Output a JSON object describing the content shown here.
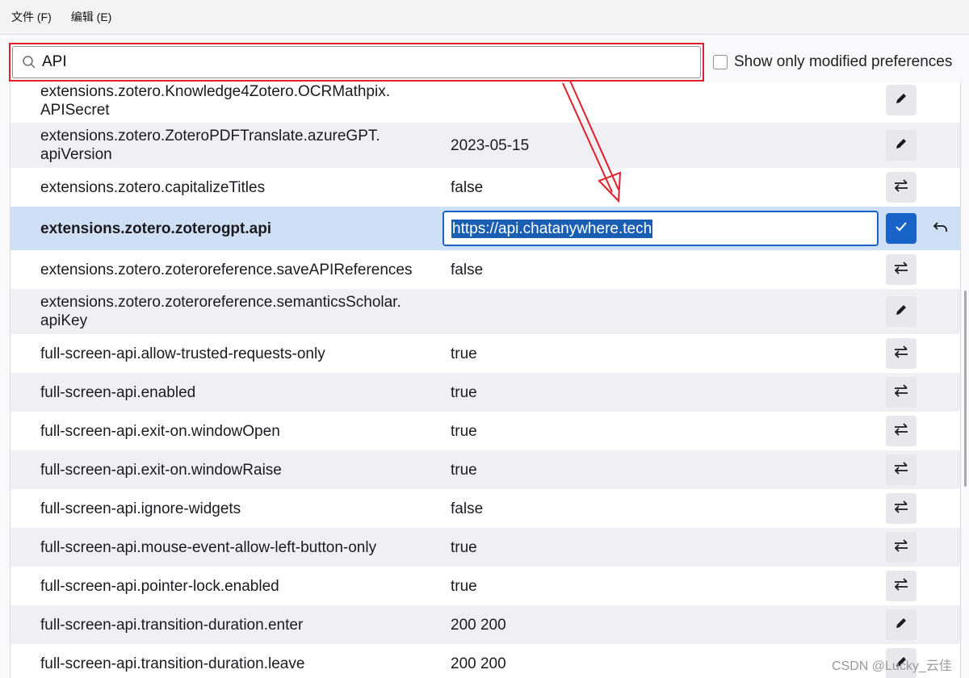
{
  "menu": {
    "file": "文件 (F)",
    "edit": "编辑 (E)"
  },
  "search": {
    "value": "API",
    "placeholder": ""
  },
  "show_modified": {
    "label": "Show only modified preferences",
    "checked": false
  },
  "rows": [
    {
      "name_line1": "extensions.zotero.Knowledge4Zotero.OCRMathpix.",
      "name_line2": "APISecret",
      "value": "",
      "action": "edit-icon"
    },
    {
      "name_line1": "extensions.zotero.ZoteroPDFTranslate.azureGPT.",
      "name_line2": "apiVersion",
      "value": "2023-05-15",
      "action": "edit-icon"
    },
    {
      "name": "extensions.zotero.capitalizeTitles",
      "value": "false",
      "action": "toggle-icon"
    },
    {
      "name": "extensions.zotero.zoterogpt.api",
      "value": "https://api.chatanywhere.tech",
      "action": "check-icon",
      "editing": true
    },
    {
      "name": "extensions.zotero.zoteroreference.saveAPIReferences",
      "value": "false",
      "action": "toggle-icon"
    },
    {
      "name_line1": "extensions.zotero.zoteroreference.semanticsScholar.",
      "name_line2": "apiKey",
      "value": "",
      "action": "edit-icon"
    },
    {
      "name": "full-screen-api.allow-trusted-requests-only",
      "value": "true",
      "action": "toggle-icon"
    },
    {
      "name": "full-screen-api.enabled",
      "value": "true",
      "action": "toggle-icon"
    },
    {
      "name": "full-screen-api.exit-on.windowOpen",
      "value": "true",
      "action": "toggle-icon"
    },
    {
      "name": "full-screen-api.exit-on.windowRaise",
      "value": "true",
      "action": "toggle-icon"
    },
    {
      "name": "full-screen-api.ignore-widgets",
      "value": "false",
      "action": "toggle-icon"
    },
    {
      "name": "full-screen-api.mouse-event-allow-left-button-only",
      "value": "true",
      "action": "toggle-icon"
    },
    {
      "name": "full-screen-api.pointer-lock.enabled",
      "value": "true",
      "action": "toggle-icon"
    },
    {
      "name": "full-screen-api.transition-duration.enter",
      "value": "200 200",
      "action": "edit-icon"
    },
    {
      "name": "full-screen-api.transition-duration.leave",
      "value": "200 200",
      "action": "edit-icon"
    }
  ],
  "watermark": "CSDN @Lucky_云佳",
  "colors": {
    "highlight": "#e0202a",
    "selected_row": "#cfe0f6",
    "accent": "#1763c7"
  }
}
